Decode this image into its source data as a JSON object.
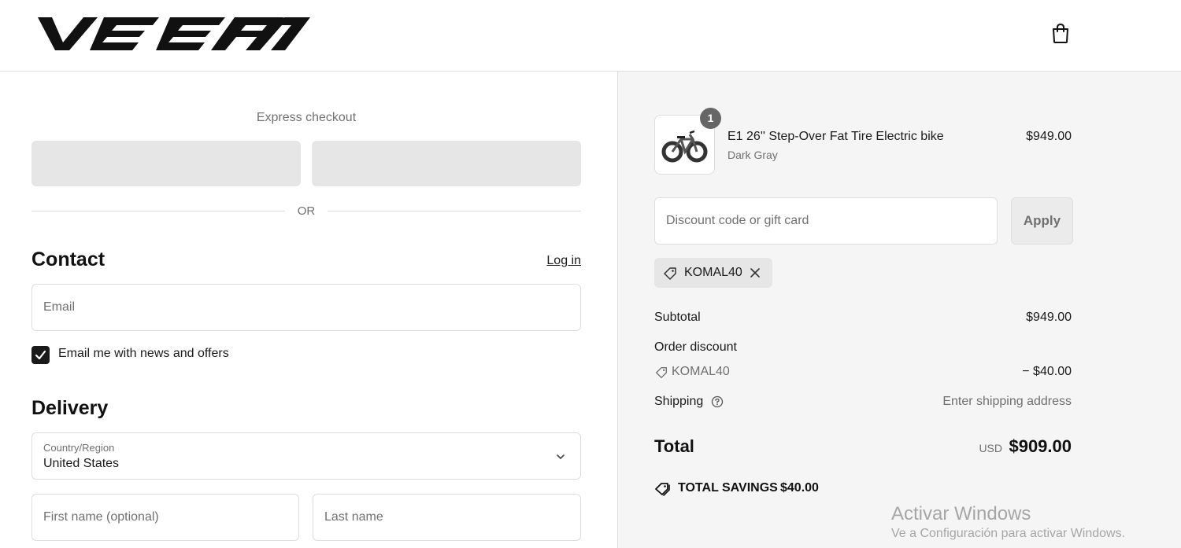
{
  "header": {
    "logo_text": "VEEFN",
    "bag_icon": "shopping-bag-icon"
  },
  "express": {
    "label": "Express checkout",
    "divider_text": "OR"
  },
  "contact": {
    "title": "Contact",
    "login_label": "Log in",
    "email_placeholder": "Email",
    "newsletter_label": "Email me with news and offers",
    "newsletter_checked": true
  },
  "delivery": {
    "title": "Delivery",
    "country_label": "Country/Region",
    "country_value": "United States",
    "first_name_placeholder": "First name (optional)",
    "last_name_placeholder": "Last name"
  },
  "order": {
    "item": {
      "quantity": "1",
      "name": "E1 26'' Step-Over Fat Tire Electric bike",
      "variant": "Dark Gray",
      "price": "$949.00"
    },
    "discount_placeholder": "Discount code or gift card",
    "apply_label": "Apply",
    "applied_code": "KOMAL40",
    "subtotal_label": "Subtotal",
    "subtotal_value": "$949.00",
    "order_discount_label": "Order discount",
    "discount_code": "KOMAL40",
    "discount_value": "− $40.00",
    "shipping_label": "Shipping",
    "shipping_value": "Enter shipping address",
    "total_label": "Total",
    "total_currency": "USD",
    "total_value": "$909.00",
    "savings_label": "TOTAL SAVINGS",
    "savings_value": "$40.00"
  },
  "watermark": {
    "title": "Activar Windows",
    "subtitle": "Ve a Configuración para activar Windows."
  },
  "colors": {
    "panel_bg": "#f5f5f5",
    "border": "#dedede",
    "muted_text": "#707070",
    "express_btn": "#e6e6e6",
    "checkbox": "#1a1a1a"
  }
}
